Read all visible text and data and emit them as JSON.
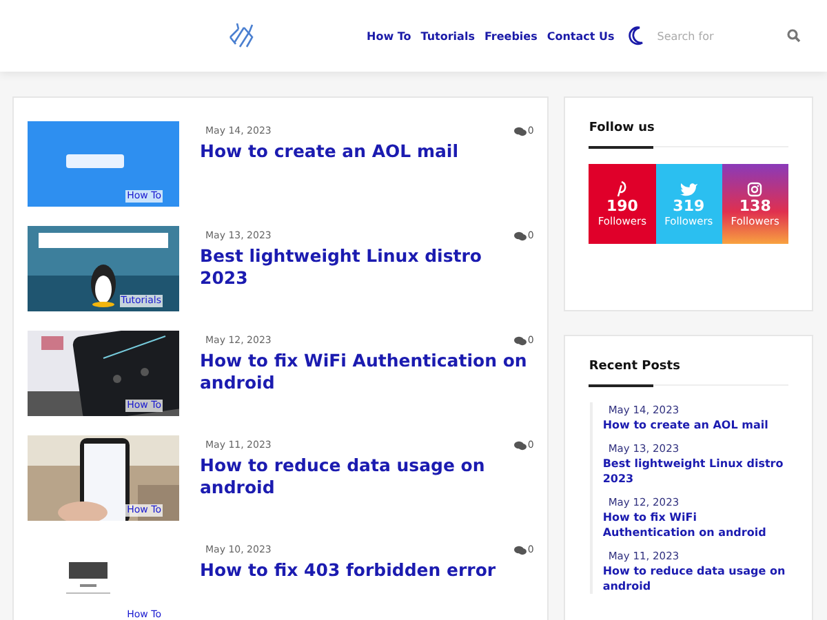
{
  "header": {
    "nav": [
      "How To",
      "Tutorials",
      "Freebies",
      "Contact Us"
    ],
    "search": {
      "placeholder": "Search for"
    }
  },
  "posts": [
    {
      "date": "May 14, 2023",
      "comments": "0",
      "title": "How to create an AOL mail",
      "category": "How To"
    },
    {
      "date": "May 13, 2023",
      "comments": "0",
      "title": "Best lightweight Linux distro 2023",
      "category": "Tutorials"
    },
    {
      "date": "May 12, 2023",
      "comments": "0",
      "title": "How to fix WiFi Authentication on android",
      "category": "How To"
    },
    {
      "date": "May 11, 2023",
      "comments": "0",
      "title": "How to reduce data usage on android",
      "category": "How To"
    },
    {
      "date": "May 10, 2023",
      "comments": "0",
      "title": "How to fix 403 forbidden error",
      "category": "How To"
    }
  ],
  "follow": {
    "title": "Follow us",
    "networks": [
      {
        "kind": "pinterest",
        "count": "190",
        "label": "Followers"
      },
      {
        "kind": "twitter",
        "count": "319",
        "label": "Followers"
      },
      {
        "kind": "instagram",
        "count": "138",
        "label": "Followers"
      }
    ]
  },
  "recent": {
    "title": "Recent Posts",
    "items": [
      {
        "date": "May 14, 2023",
        "title": "How to create an AOL mail"
      },
      {
        "date": "May 13, 2023",
        "title": "Best lightweight Linux distro 2023"
      },
      {
        "date": "May 12, 2023",
        "title": "How to fix WiFi Authentication on android"
      },
      {
        "date": "May 11, 2023",
        "title": "How to reduce data usage on android"
      }
    ]
  }
}
